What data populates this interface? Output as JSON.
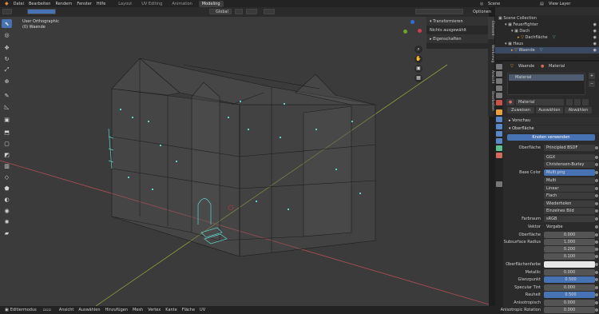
{
  "topbar": {
    "menus": [
      "Datei",
      "Bearbeiten",
      "Rendern",
      "Fenster",
      "Hilfe"
    ],
    "workspaces": [
      "Layout",
      "UV Editing",
      "Animation",
      "Modeling"
    ],
    "active_workspace": "Modeling",
    "scene_label": "Scene",
    "view_layer_label": "View Layer"
  },
  "header": {
    "orientation": "Global",
    "options_label": "Optionen"
  },
  "viewport": {
    "view_name": "User Orthographic",
    "object_name": "(0) Waende"
  },
  "npanel": {
    "transform_label": "Transformieren",
    "nothing_selected": "Nichts ausgewählt",
    "properties_label": "Eigenschaften"
  },
  "sidetabs": [
    "Element",
    "Werkzeug",
    "Ansicht",
    "Bearbeiten"
  ],
  "bottombar": {
    "mode": "Editiermodus",
    "menus": [
      "Ansicht",
      "Auswählen",
      "Hinzufügen",
      "Mesh",
      "Vertex",
      "Kante",
      "Fläche",
      "UV"
    ]
  },
  "outliner": {
    "rows": [
      {
        "label": "Scene Collection",
        "indent": 0
      },
      {
        "label": "FeuerFighter",
        "indent": 1
      },
      {
        "label": "Dach",
        "indent": 2
      },
      {
        "label": "Dachfläche",
        "indent": 3
      },
      {
        "label": "Haus",
        "indent": 1
      },
      {
        "label": "Waende",
        "indent": 2
      }
    ]
  },
  "properties": {
    "object_label": "Waende",
    "material_tab_label": "Material",
    "material_slot": "Material",
    "material_name": "Material",
    "link_buttons": [
      "Zuweisen",
      "Auswählen",
      "Abwählen"
    ],
    "preview_label": "Vorschau",
    "surface_label": "Oberfläche",
    "use_nodes_button": "Knoten verwenden",
    "rows": [
      {
        "label": "Oberfläche",
        "value": "Principled BSDF",
        "kind": "text"
      },
      {
        "label": "",
        "value": "GGX",
        "kind": "text"
      },
      {
        "label": "",
        "value": "Christensen-Burley",
        "kind": "text"
      },
      {
        "label": "Base Color",
        "value": "Multi.png",
        "kind": "blue"
      },
      {
        "label": "",
        "value": "Multi",
        "kind": "text"
      },
      {
        "label": "",
        "value": "Linear",
        "kind": "text"
      },
      {
        "label": "",
        "value": "Flach",
        "kind": "text"
      },
      {
        "label": "",
        "value": "Wiederholen",
        "kind": "text"
      },
      {
        "label": "",
        "value": "Einzelnes Bild",
        "kind": "text"
      },
      {
        "label": "Farbraum",
        "value": "sRGB",
        "kind": "text"
      },
      {
        "label": "Vektor",
        "value": "Vorgabe",
        "kind": "plain"
      },
      {
        "label": "Oberfläche",
        "value": "0.000",
        "kind": "num"
      },
      {
        "label": "Subsurface Radius",
        "value": "1.000",
        "kind": "num"
      },
      {
        "label": "",
        "value": "0.200",
        "kind": "num"
      },
      {
        "label": "",
        "value": "0.100",
        "kind": "num"
      },
      {
        "label": "Oberflächenfarbe",
        "value": "",
        "kind": "white"
      },
      {
        "label": "Metallic",
        "value": "0.000",
        "kind": "num"
      },
      {
        "label": "Glanzpunkt",
        "value": "0.500",
        "kind": "blue"
      },
      {
        "label": "Specular Tint",
        "value": "0.000",
        "kind": "num"
      },
      {
        "label": "Rauheit",
        "value": "0.500",
        "kind": "blue"
      },
      {
        "label": "Anisotropisch",
        "value": "0.000",
        "kind": "num"
      },
      {
        "label": "Anisotropic Rotation",
        "value": "0.000",
        "kind": "num"
      }
    ]
  },
  "colors": {
    "accent": "#4772b3",
    "viewport_bg": "#3b3b3b",
    "panel_bg": "#2b2b2b",
    "wire": "#1e1e1e",
    "vertex": "#5fd3c7"
  }
}
